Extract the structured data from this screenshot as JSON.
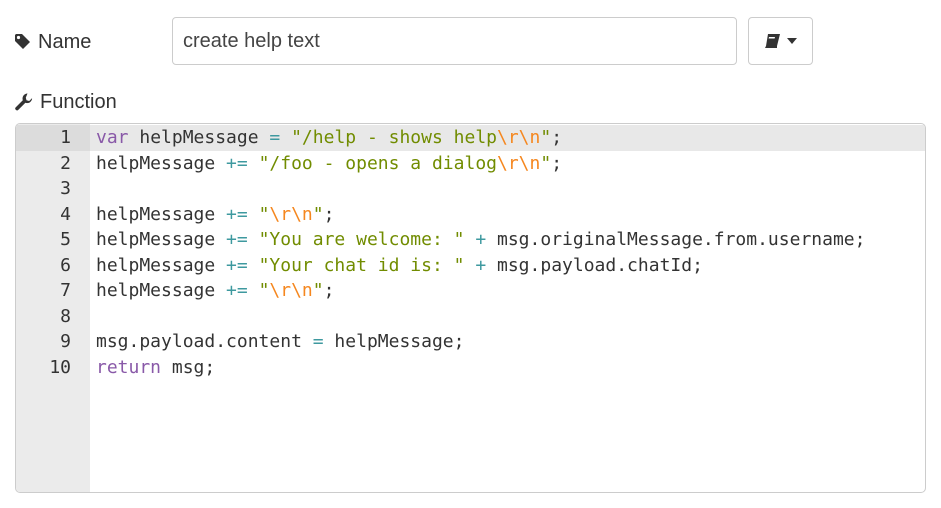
{
  "name_row": {
    "label": "Name",
    "label_icon": "tag-icon",
    "value": "create help text",
    "library_button_icon": "book-icon"
  },
  "function_row": {
    "label": "Function",
    "label_icon": "wrench-icon"
  },
  "editor": {
    "active_line": 1,
    "lines": [
      {
        "num": "1",
        "tokens": [
          {
            "t": "kw",
            "v": "var"
          },
          {
            "t": "txt",
            "v": " helpMessage "
          },
          {
            "t": "op",
            "v": "="
          },
          {
            "t": "txt",
            "v": " "
          },
          {
            "t": "str",
            "v": "\"/help - shows help"
          },
          {
            "t": "esc",
            "v": "\\r\\n"
          },
          {
            "t": "str",
            "v": "\""
          },
          {
            "t": "txt",
            "v": ";"
          }
        ]
      },
      {
        "num": "2",
        "tokens": [
          {
            "t": "txt",
            "v": "helpMessage "
          },
          {
            "t": "op",
            "v": "+="
          },
          {
            "t": "txt",
            "v": " "
          },
          {
            "t": "str",
            "v": "\"/foo - opens a dialog"
          },
          {
            "t": "esc",
            "v": "\\r\\n"
          },
          {
            "t": "str",
            "v": "\""
          },
          {
            "t": "txt",
            "v": ";"
          }
        ]
      },
      {
        "num": "3",
        "tokens": []
      },
      {
        "num": "4",
        "tokens": [
          {
            "t": "txt",
            "v": "helpMessage "
          },
          {
            "t": "op",
            "v": "+="
          },
          {
            "t": "txt",
            "v": " "
          },
          {
            "t": "str",
            "v": "\""
          },
          {
            "t": "esc",
            "v": "\\r\\n"
          },
          {
            "t": "str",
            "v": "\""
          },
          {
            "t": "txt",
            "v": ";"
          }
        ]
      },
      {
        "num": "5",
        "tokens": [
          {
            "t": "txt",
            "v": "helpMessage "
          },
          {
            "t": "op",
            "v": "+="
          },
          {
            "t": "txt",
            "v": " "
          },
          {
            "t": "str",
            "v": "\"You are welcome: \""
          },
          {
            "t": "txt",
            "v": " "
          },
          {
            "t": "op",
            "v": "+"
          },
          {
            "t": "txt",
            "v": " msg.originalMessage.from.username;"
          }
        ]
      },
      {
        "num": "6",
        "tokens": [
          {
            "t": "txt",
            "v": "helpMessage "
          },
          {
            "t": "op",
            "v": "+="
          },
          {
            "t": "txt",
            "v": " "
          },
          {
            "t": "str",
            "v": "\"Your chat id is: \""
          },
          {
            "t": "txt",
            "v": " "
          },
          {
            "t": "op",
            "v": "+"
          },
          {
            "t": "txt",
            "v": " msg.payload.chatId;"
          }
        ]
      },
      {
        "num": "7",
        "tokens": [
          {
            "t": "txt",
            "v": "helpMessage "
          },
          {
            "t": "op",
            "v": "+="
          },
          {
            "t": "txt",
            "v": " "
          },
          {
            "t": "str",
            "v": "\""
          },
          {
            "t": "esc",
            "v": "\\r\\n"
          },
          {
            "t": "str",
            "v": "\""
          },
          {
            "t": "txt",
            "v": ";"
          }
        ]
      },
      {
        "num": "8",
        "tokens": []
      },
      {
        "num": "9",
        "tokens": [
          {
            "t": "txt",
            "v": "msg.payload.content "
          },
          {
            "t": "op",
            "v": "="
          },
          {
            "t": "txt",
            "v": " helpMessage;"
          }
        ]
      },
      {
        "num": "10",
        "tokens": [
          {
            "t": "kw",
            "v": "return"
          },
          {
            "t": "txt",
            "v": " msg;"
          }
        ]
      }
    ]
  }
}
